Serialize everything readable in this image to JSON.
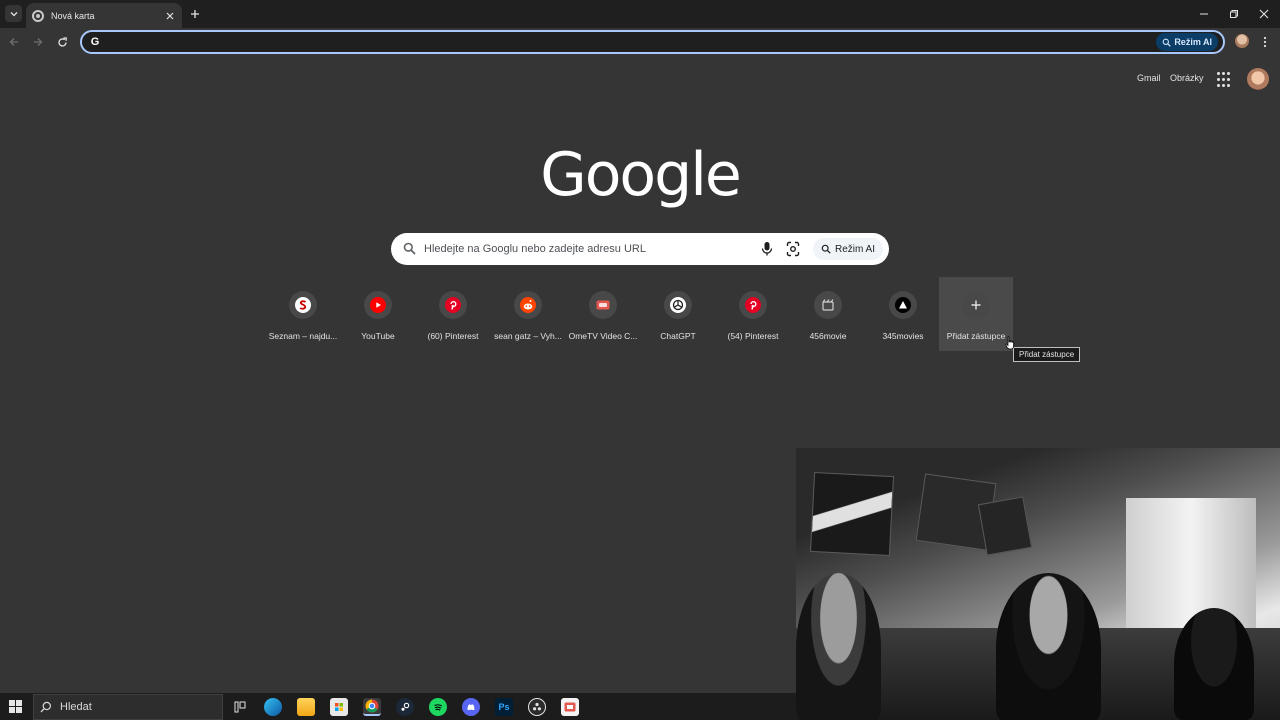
{
  "browser": {
    "tab": {
      "title": "Nová karta"
    },
    "omnibox": {
      "value": "",
      "ai_mode_label": "Režim AI"
    }
  },
  "header": {
    "gmail_label": "Gmail",
    "images_label": "Obrázky"
  },
  "logo_text": "Google",
  "search": {
    "placeholder": "Hledejte na Googlu nebo zadejte adresu URL",
    "ai_mode_label": "Režim AI"
  },
  "shortcuts": [
    {
      "label": "Seznam – najdu...",
      "icon": "seznam-icon",
      "color": "#cc0000"
    },
    {
      "label": "YouTube",
      "icon": "youtube-icon",
      "color": "#ff0000"
    },
    {
      "label": "(60) Pinterest",
      "icon": "pinterest-icon",
      "color": "#e60023"
    },
    {
      "label": "sean gatz – Vyh...",
      "icon": "reddit-icon",
      "color": "#ff4500"
    },
    {
      "label": "OmeTV Video C...",
      "icon": "ometv-icon",
      "color": "#e3574f"
    },
    {
      "label": "ChatGPT",
      "icon": "chatgpt-icon",
      "color": "#ffffff"
    },
    {
      "label": "(54) Pinterest",
      "icon": "pinterest-icon",
      "color": "#e60023"
    },
    {
      "label": "456movie",
      "icon": "movie-icon",
      "color": "#cfcfcf"
    },
    {
      "label": "345movies",
      "icon": "triangle-icon",
      "color": "#000000"
    },
    {
      "label": "Přidat zástupce",
      "icon": "plus-icon",
      "color": "#e3e3e3"
    }
  ],
  "tooltip": "Přidat zástupce",
  "taskbar": {
    "search_label": "Hledat",
    "apps": [
      "task-view-icon",
      "edge-icon",
      "file-explorer-icon",
      "store-icon",
      "chrome-icon",
      "steam-icon",
      "spotify-icon",
      "discord-icon",
      "photoshop-icon",
      "obs-icon",
      "ometv-icon"
    ]
  }
}
